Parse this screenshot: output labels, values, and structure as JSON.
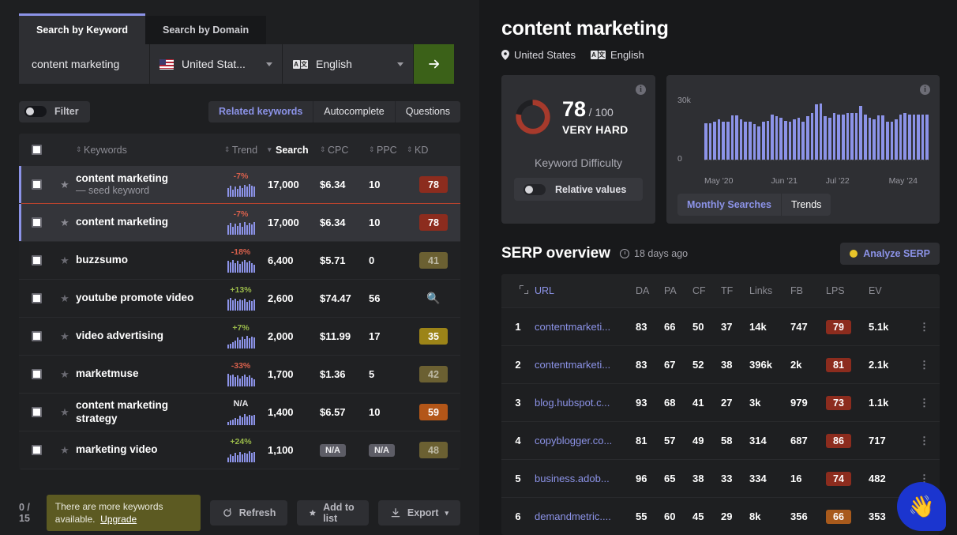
{
  "left": {
    "tabs": [
      {
        "label": "Search by Keyword",
        "active": true
      },
      {
        "label": "Search by Domain",
        "active": false
      }
    ],
    "search": {
      "keyword": "content marketing",
      "country": "United Stat...",
      "language": "English",
      "go_icon": "arrow-right-icon"
    },
    "filter_label": "Filter",
    "segments": [
      {
        "label": "Related keywords",
        "active": true
      },
      {
        "label": "Autocomplete",
        "active": false
      },
      {
        "label": "Questions",
        "active": false
      }
    ],
    "table": {
      "columns": [
        "Keywords",
        "Trend",
        "Search",
        "CPC",
        "PPC",
        "KD"
      ],
      "sorted_column": "Search",
      "rows": [
        {
          "keyword": "content marketing",
          "sub": "— seed keyword",
          "trend": "-7%",
          "trend_dir": "down",
          "spark": [
            11,
            14,
            9,
            13,
            10,
            14,
            11,
            15,
            13,
            16,
            14,
            13
          ],
          "search": "17,000",
          "cpc": "$6.34",
          "ppc": "10",
          "kd": "78",
          "kd_color": "#8c2c1e",
          "kd_text": "#ffffff",
          "selected": true,
          "redline": true
        },
        {
          "keyword": "content marketing",
          "sub": "",
          "trend": "-7%",
          "trend_dir": "down",
          "spark": [
            12,
            15,
            10,
            14,
            11,
            15,
            10,
            16,
            12,
            15,
            13,
            16
          ],
          "search": "17,000",
          "cpc": "$6.34",
          "ppc": "10",
          "kd": "78",
          "kd_color": "#8c2c1e",
          "kd_text": "#ffffff",
          "selected": true,
          "redline": false
        },
        {
          "keyword": "buzzsumo",
          "sub": "",
          "trend": "-18%",
          "trend_dir": "down",
          "spark": [
            15,
            13,
            16,
            12,
            15,
            11,
            14,
            16,
            13,
            15,
            12,
            10
          ],
          "search": "6,400",
          "cpc": "$5.71",
          "ppc": "0",
          "kd": "41",
          "kd_color": "#6b6032",
          "kd_text": "#bdb9a5",
          "selected": false,
          "redline": false
        },
        {
          "keyword": "youtube promote video",
          "sub": "",
          "trend": "+13%",
          "trend_dir": "up",
          "spark": [
            14,
            16,
            13,
            15,
            12,
            14,
            13,
            15,
            11,
            13,
            12,
            14
          ],
          "search": "2,600",
          "cpc": "$74.47",
          "ppc": "56",
          "kd": "",
          "kd_icon": "search-icon",
          "selected": false,
          "redline": false
        },
        {
          "keyword": "video advertising",
          "sub": "",
          "trend": "+7%",
          "trend_dir": "up",
          "spark": [
            5,
            6,
            8,
            10,
            14,
            11,
            15,
            12,
            16,
            13,
            15,
            14
          ],
          "search": "2,000",
          "cpc": "$11.99",
          "ppc": "17",
          "kd": "35",
          "kd_color": "#9c8418",
          "kd_text": "#ffffff",
          "selected": false,
          "redline": false
        },
        {
          "keyword": "marketmuse",
          "sub": "",
          "trend": "-33%",
          "trend_dir": "down",
          "spark": [
            16,
            14,
            15,
            12,
            14,
            10,
            13,
            15,
            12,
            14,
            11,
            9
          ],
          "search": "1,700",
          "cpc": "$1.36",
          "ppc": "5",
          "kd": "42",
          "kd_color": "#6b6032",
          "kd_text": "#bdb9a5",
          "selected": false,
          "redline": false
        },
        {
          "keyword": "content marketing strategy",
          "sub": "",
          "trend": "N/A",
          "trend_dir": "na",
          "spark": [
            4,
            6,
            7,
            9,
            8,
            12,
            10,
            14,
            11,
            13,
            12,
            13
          ],
          "search": "1,400",
          "cpc": "$6.57",
          "ppc": "10",
          "kd": "59",
          "kd_color": "#b35618",
          "kd_text": "#ffffff",
          "selected": false,
          "redline": false
        },
        {
          "keyword": "marketing video",
          "sub": "",
          "trend": "+24%",
          "trend_dir": "up",
          "spark": [
            6,
            10,
            8,
            12,
            9,
            13,
            10,
            12,
            11,
            14,
            12,
            13
          ],
          "search": "1,100",
          "cpc": "N/A",
          "cpc_na": true,
          "ppc": "N/A",
          "ppc_na": true,
          "kd": "48",
          "kd_color": "#6b6032",
          "kd_text": "#bdb9a5",
          "selected": false,
          "redline": false
        }
      ]
    },
    "footer": {
      "count": "0 / 15",
      "upsell_text": "There are more keywords available.",
      "upsell_link": "Upgrade",
      "refresh_label": "Refresh",
      "addlist_label": "Add to list",
      "export_label": "Export"
    }
  },
  "right": {
    "title": "content marketing",
    "meta": {
      "country": "United States",
      "language": "English"
    },
    "kd_card": {
      "value": "78",
      "denominator": "/ 100",
      "verdict": "VERY HARD",
      "label": "Keyword Difficulty",
      "toggle_label": "Relative values",
      "arc_color": "#a63a2c",
      "arc_percent": 78
    },
    "ms_card": {
      "tabs": [
        {
          "label": "Monthly Searches",
          "active": true
        },
        {
          "label": "Trends",
          "active": false
        }
      ]
    },
    "serp": {
      "title": "SERP overview",
      "age": "18 days ago",
      "analyze_label": "Analyze SERP",
      "columns": [
        "URL",
        "DA",
        "PA",
        "CF",
        "TF",
        "Links",
        "FB",
        "LPS",
        "EV"
      ],
      "rows": [
        {
          "rank": "1",
          "url": "contentmarketi...",
          "da": "83",
          "pa": "66",
          "cf": "50",
          "tf": "37",
          "links": "14k",
          "fb": "747",
          "lps": "79",
          "lps_color": "#8c2c1e",
          "ev": "5.1k"
        },
        {
          "rank": "2",
          "url": "contentmarketi...",
          "da": "83",
          "pa": "67",
          "cf": "52",
          "tf": "38",
          "links": "396k",
          "fb": "2k",
          "lps": "81",
          "lps_color": "#8c2c1e",
          "ev": "2.1k"
        },
        {
          "rank": "3",
          "url": "blog.hubspot.c...",
          "da": "93",
          "pa": "68",
          "cf": "41",
          "tf": "27",
          "links": "3k",
          "fb": "979",
          "lps": "73",
          "lps_color": "#8c2c1e",
          "ev": "1.1k"
        },
        {
          "rank": "4",
          "url": "copyblogger.co...",
          "da": "81",
          "pa": "57",
          "cf": "49",
          "tf": "58",
          "links": "314",
          "fb": "687",
          "lps": "86",
          "lps_color": "#8c2c1e",
          "ev": "717"
        },
        {
          "rank": "5",
          "url": "business.adob...",
          "da": "96",
          "pa": "65",
          "cf": "38",
          "tf": "33",
          "links": "334",
          "fb": "16",
          "lps": "74",
          "lps_color": "#8c2c1e",
          "ev": "482"
        },
        {
          "rank": "6",
          "url": "demandmetric....",
          "da": "55",
          "pa": "60",
          "cf": "45",
          "tf": "29",
          "links": "8k",
          "fb": "356",
          "lps": "66",
          "lps_color": "#a85a1c",
          "ev": "353"
        }
      ]
    },
    "chat_icon": "waving-hand-icon"
  },
  "chart_data": {
    "type": "bar",
    "title": "Monthly Searches",
    "xlabel": "",
    "ylabel": "",
    "ylim": [
      0,
      30000
    ],
    "yticks": [
      "0",
      "30k"
    ],
    "grid": false,
    "legend": "none",
    "tick_labels": [
      "May '20",
      "Jun '21",
      "Jul '22",
      "May '24"
    ],
    "categories": [
      "May '20",
      "Jun '20",
      "Jul '20",
      "Aug '20",
      "Sep '20",
      "Oct '20",
      "Nov '20",
      "Dec '20",
      "Jan '21",
      "Feb '21",
      "Mar '21",
      "Apr '21",
      "May '21",
      "Jun '21",
      "Jul '21",
      "Aug '21",
      "Sep '21",
      "Oct '21",
      "Nov '21",
      "Dec '21",
      "Jan '22",
      "Feb '22",
      "Mar '22",
      "Apr '22",
      "May '22",
      "Jun '22",
      "Jul '22",
      "Aug '22",
      "Sep '22",
      "Oct '22",
      "Nov '22",
      "Dec '22",
      "Jan '23",
      "Feb '23",
      "Mar '23",
      "Apr '23",
      "May '23",
      "Jun '23",
      "Jul '23",
      "Aug '23",
      "Sep '23",
      "Oct '23",
      "Nov '23",
      "Dec '23",
      "Jan '24",
      "Feb '24",
      "Mar '24",
      "Apr '24",
      "May '24",
      "Jun '24",
      "Jul '24"
    ],
    "values": [
      17000,
      17000,
      17500,
      18500,
      17500,
      17500,
      20500,
      20500,
      18500,
      17500,
      17500,
      16500,
      15500,
      17500,
      18000,
      21000,
      20000,
      19500,
      18000,
      17500,
      18500,
      19500,
      17500,
      20000,
      21500,
      25500,
      26000,
      20000,
      19500,
      21500,
      21000,
      21000,
      21500,
      21500,
      21500,
      25000,
      21000,
      19500,
      18500,
      20500,
      20500,
      17500,
      17500,
      18500,
      21000,
      21500,
      21000,
      21000,
      21000,
      21000,
      21000
    ]
  }
}
